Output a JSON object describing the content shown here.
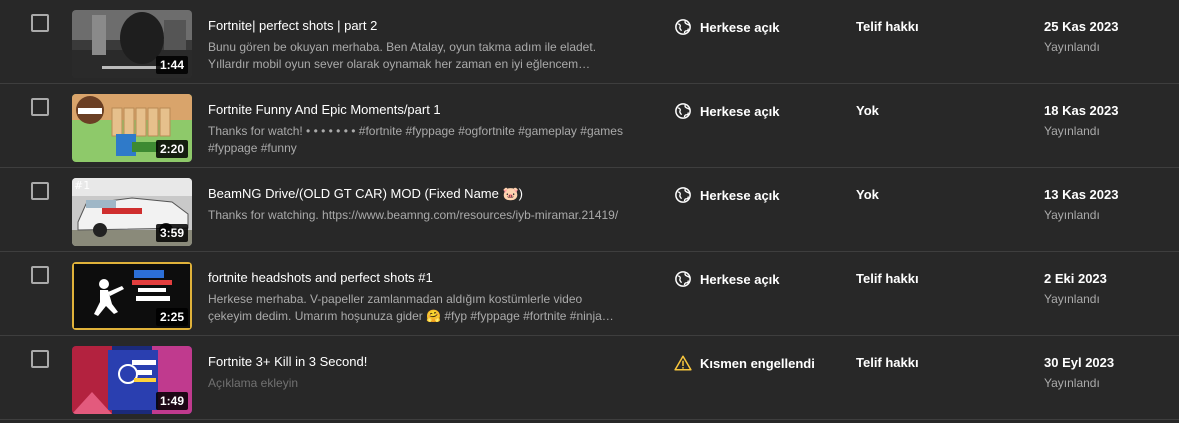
{
  "colors": {
    "background": "#282828",
    "divider": "#3e3e3e",
    "text_primary": "#ffffff",
    "text_secondary": "#aaaaaa",
    "warning": "#f9c73d"
  },
  "videos": [
    {
      "title": "Fortnite| perfect shots | part 2",
      "description": "Bunu gören be okuyan merhaba. Ben Atalay, oyun takma adım ile eladet. Yıllardır mobil oyun sever olarak oynamak her zaman en iyi eğlencem…",
      "duration": "1:44",
      "visibility": "Herkese açık",
      "visibility_icon": "globe-icon",
      "restriction": "Telif hakkı",
      "date": "25 Kas 2023",
      "date_status": "Yayınlandı"
    },
    {
      "title": "Fortnite Funny And Epic Moments/part 1",
      "description": "Thanks for watch! • • • • • • • #fortnite #fyppage #ogfortnite #gameplay #games #fyppage #funny",
      "duration": "2:20",
      "visibility": "Herkese açık",
      "visibility_icon": "globe-icon",
      "restriction": "Yok",
      "date": "18 Kas 2023",
      "date_status": "Yayınlandı"
    },
    {
      "title": "BeamNG Drive/(OLD GT CAR) MOD (Fixed Name 🐷)",
      "description": "Thanks for watching. https://www.beamng.com/resources/iyb-miramar.21419/",
      "duration": "3:59",
      "thumb_tag": "#1",
      "visibility": "Herkese açık",
      "visibility_icon": "globe-icon",
      "restriction": "Yok",
      "date": "13 Kas 2023",
      "date_status": "Yayınlandı"
    },
    {
      "title": "fortnite headshots and perfect shots #1",
      "description": "Herkese merhaba. V-papeller zamlanmadan aldığım kostümlerle video çekeyim dedim. Umarım hoşunuza gider 🤗 #fyp #fyppage #fortnite #ninja…",
      "duration": "2:25",
      "visibility": "Herkese açık",
      "visibility_icon": "globe-icon",
      "restriction": "Telif hakkı",
      "date": "2 Eki 2023",
      "date_status": "Yayınlandı"
    },
    {
      "title": "Fortnite 3+ Kill in 3 Second!",
      "description": "Açıklama ekleyin",
      "duration": "1:49",
      "visibility": "Kısmen engellendi",
      "visibility_icon": "warning-icon",
      "restriction": "Telif hakkı",
      "date": "30 Eyl 2023",
      "date_status": "Yayınlandı"
    }
  ]
}
